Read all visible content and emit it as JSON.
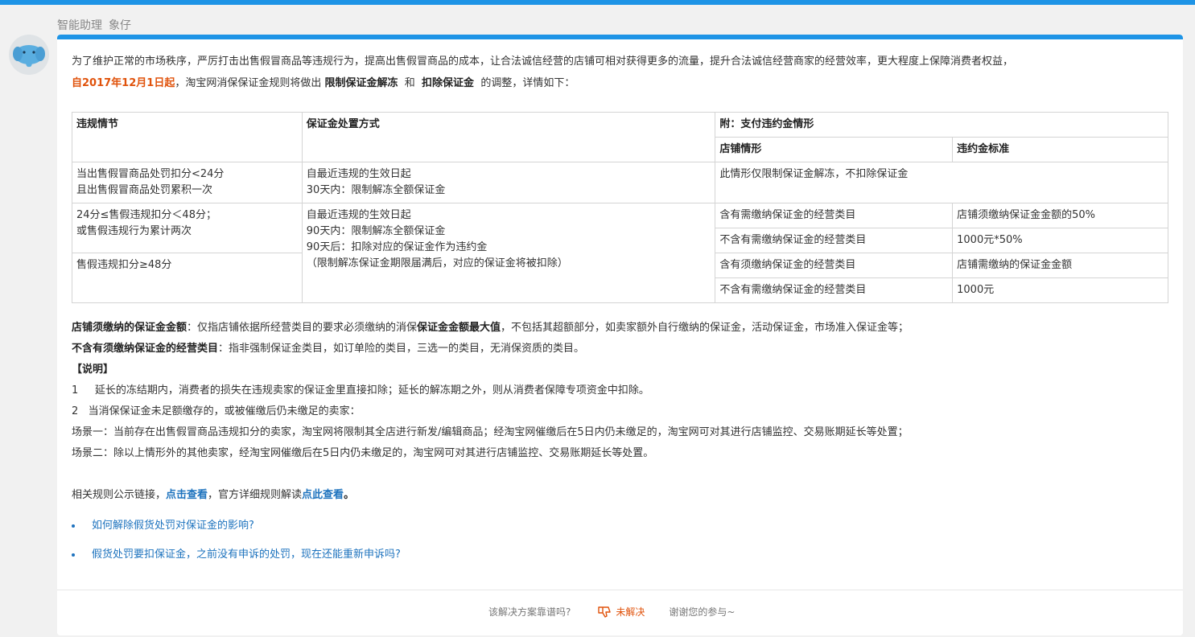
{
  "header": {
    "assistant_label": "智能助理",
    "assistant_name": "象仔"
  },
  "intro": {
    "line1": "为了维护正常的市场秩序，严厉打击出售假冒商品等违规行为，提高出售假冒商品的成本，让合法诚信经营的店铺可相对获得更多的流量，提升合法诚信经营商家的经营效率，更大程度上保障消费者权益，",
    "date": "自2017年12月1日起",
    "mid": "，淘宝网消保保证金规则将做出",
    "term1": "限制保证金解冻",
    "and": "和",
    "term2": "扣除保证金",
    "tail": "的调整，详情如下："
  },
  "table": {
    "col1_header": "违规情节",
    "col2_header": "保证金处置方式",
    "col3_header": "附：支付违约金情形",
    "sub_header_a": "店铺情形",
    "sub_header_b": "违约金标准",
    "row1": {
      "violation_1": "当出售假冒商品处罚扣分<24分",
      "violation_2": "且出售假冒商品处罚累积一次",
      "handling_1": "自最近违规的生效日起",
      "handling_2": "30天内：限制解冻全额保证金",
      "note": "此情形仅限制保证金解冻，不扣除保证金"
    },
    "row2": {
      "violation_1": "24分≤售假违规扣分＜48分；",
      "violation_2": "或售假违规行为累计两次",
      "handling_1": "自最近违规的生效日起",
      "handling_2": "90天内：限制解冻全额保证金",
      "handling_3": "90天后：扣除对应的保证金作为违约金",
      "handling_4": "（限制解冻保证金期限届满后，对应的保证金将被扣除）",
      "case_a": "含有需缴纳保证金的经营类目",
      "standard_a": "店铺须缴纳保证金金额的50%",
      "case_b": "不含有需缴纳保证金的经营类目",
      "standard_b": "1000元*50%"
    },
    "row3": {
      "violation_1": "售假违规扣分≥48分",
      "case_a": "含有须缴纳保证金的经营类目",
      "standard_a": "店铺需缴纳的保证金金额",
      "case_b": "不含有需缴纳保证金的经营类目",
      "standard_b": "1000元"
    }
  },
  "notes": {
    "def1_term": "店铺须缴纳的保证金金额",
    "def1_text_a": "：仅指店铺依据所经营类目的要求必须缴纳的消保",
    "def1_bold": "保证金金额最大值",
    "def1_text_b": "，不包括其超额部分，如卖家额外自行缴纳的保证金，活动保证金，市场准入保证金等；",
    "def2_term": "不含有须缴纳保证金的经营类目",
    "def2_text": "：指非强制保证金类目，如订单险的类目，三选一的类目，无消保资质的类目。",
    "explain_title": "【说明】",
    "item1": "1     延长的冻结期内，消费者的损失在违规卖家的保证金里直接扣除；延长的解冻期之外，则从消费者保障专项资金中扣除。",
    "item2": "2   当消保保证金未足额缴存的，或被催缴后仍未缴足的卖家：",
    "scene1": "场景一：当前存在出售假冒商品违规扣分的卖家，淘宝网将限制其全店进行新发/编辑商品；经淘宝网催缴后在5日内仍未缴足的，淘宝网可对其进行店铺监控、交易账期延长等处置；",
    "scene2": "场景二：除以上情形外的其他卖家，经淘宝网催缴后在5日内仍未缴足的，淘宝网可对其进行店铺监控、交易账期延长等处置。",
    "links_prefix": "相关规则公示链接，",
    "link1": "点击查看",
    "links_mid": "，官方详细规则解读",
    "link2": "点此查看",
    "links_end": "。"
  },
  "related_questions": [
    "如何解除假货处罚对保证金的影响?",
    "假货处罚要扣保证金，之前没有申诉的处罚，现在还能重新申诉吗?"
  ],
  "feedback": {
    "question": "该解决方案靠谱吗?",
    "unsolved": "未解决",
    "thanks": "谢谢您的参与~"
  },
  "colors": {
    "accent": "#1e94e6",
    "highlight": "#e0520b",
    "link": "#1e73be"
  }
}
